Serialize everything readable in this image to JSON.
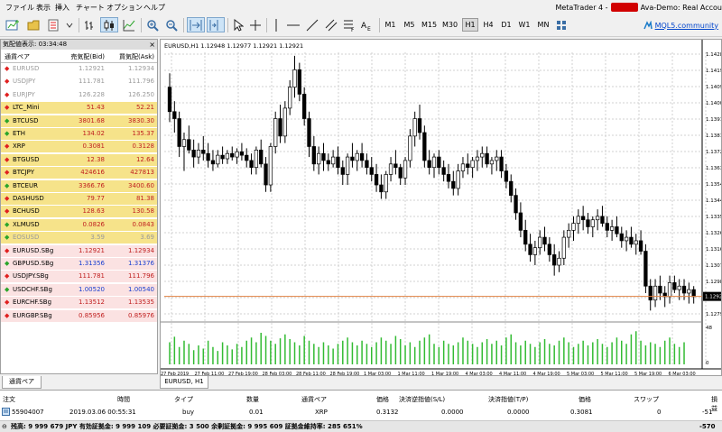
{
  "menu": [
    "ファイル",
    "表示",
    "挿入",
    "チャート",
    "オプション",
    "ヘルプ"
  ],
  "title": {
    "app": "MetaTrader 4 -",
    "account": "Ava-Demo: Real Accou"
  },
  "timeframes": [
    "M1",
    "M5",
    "M15",
    "M30",
    "H1",
    "H4",
    "D1",
    "W1",
    "MN"
  ],
  "selected_timeframe": "H1",
  "mql_link": "MQL5.community",
  "market_watch": {
    "title": "気配値表示: 03:34:48",
    "close": "×",
    "headers": {
      "symbol": "通貨ペア",
      "bid": "売気配(Bid)",
      "ask": "買気配(Ask)"
    },
    "rows": [
      {
        "symbol": "EURUSD",
        "bid": "1.12921",
        "ask": "1.12934",
        "dir": "down",
        "group": "dim"
      },
      {
        "symbol": "USDJPY",
        "bid": "111.781",
        "ask": "111.796",
        "dir": "down",
        "group": "dim"
      },
      {
        "symbol": "EURJPY",
        "bid": "126.228",
        "ask": "126.250",
        "dir": "down",
        "group": "dim"
      },
      {
        "symbol": "LTC_Mini",
        "bid": "51.43",
        "ask": "52.21",
        "dir": "down",
        "group": "crypto"
      },
      {
        "symbol": "BTCUSD",
        "bid": "3801.68",
        "ask": "3830.30",
        "dir": "up",
        "group": "crypto"
      },
      {
        "symbol": "ETH",
        "bid": "134.02",
        "ask": "135.37",
        "dir": "up",
        "group": "crypto"
      },
      {
        "symbol": "XRP",
        "bid": "0.3081",
        "ask": "0.3128",
        "dir": "down",
        "group": "crypto"
      },
      {
        "symbol": "BTGUSD",
        "bid": "12.38",
        "ask": "12.64",
        "dir": "down",
        "group": "crypto"
      },
      {
        "symbol": "BTCJPY",
        "bid": "424616",
        "ask": "427813",
        "dir": "down",
        "group": "crypto"
      },
      {
        "symbol": "BTCEUR",
        "bid": "3366.76",
        "ask": "3400.60",
        "dir": "up",
        "group": "crypto"
      },
      {
        "symbol": "DASHUSD",
        "bid": "79.77",
        "ask": "81.38",
        "dir": "down",
        "group": "crypto"
      },
      {
        "symbol": "BCHUSD",
        "bid": "128.63",
        "ask": "130.58",
        "dir": "down",
        "group": "crypto"
      },
      {
        "symbol": "XLMUSD",
        "bid": "0.0826",
        "ask": "0.0843",
        "dir": "up",
        "group": "crypto"
      },
      {
        "symbol": "EOSUSD",
        "bid": "3.59",
        "ask": "3.69",
        "dir": "up",
        "group": "crypto-dim"
      },
      {
        "symbol": "EURUSD.SBg",
        "bid": "1.12921",
        "ask": "1.12934",
        "dir": "down",
        "group": "sbg"
      },
      {
        "symbol": "GBPUSD.SBg",
        "bid": "1.31356",
        "ask": "1.31376",
        "dir": "up",
        "group": "sbg"
      },
      {
        "symbol": "USDJPY.SBg",
        "bid": "111.781",
        "ask": "111.796",
        "dir": "down",
        "group": "sbg"
      },
      {
        "symbol": "USDCHF.SBg",
        "bid": "1.00520",
        "ask": "1.00540",
        "dir": "up",
        "group": "sbg"
      },
      {
        "symbol": "EURCHF.SBg",
        "bid": "1.13512",
        "ask": "1.13535",
        "dir": "down",
        "group": "sbg"
      },
      {
        "symbol": "EURGBP.SBg",
        "bid": "0.85956",
        "ask": "0.85976",
        "dir": "down",
        "group": "sbg"
      }
    ],
    "tab": "通貨ペア"
  },
  "chart": {
    "header": "EURUSD,H1  1.12948 1.12977 1.12921 1.12921",
    "tab": "EURUSD, H1",
    "current_price": "1.12921",
    "price_ticks": [
      "1.14283",
      "1.14191",
      "1.14099",
      "1.14004",
      "1.13912",
      "1.13819",
      "1.13727",
      "1.13632",
      "1.13540",
      "1.13448",
      "1.13355",
      "1.13263",
      "1.13169",
      "1.13077",
      "1.12984",
      "1.12890",
      "1.12798"
    ],
    "time_ticks": [
      "27 Feb 2019",
      "27 Feb 11:00",
      "27 Feb 19:00",
      "28 Feb 03:00",
      "28 Feb 11:00",
      "28 Feb 19:00",
      "1 Mar 03:00",
      "1 Mar 11:00",
      "1 Mar 19:00",
      "4 Mar 03:00",
      "4 Mar 11:00",
      "4 Mar 19:00",
      "5 Mar 03:00",
      "5 Mar 11:00",
      "5 Mar 19:00",
      "6 Mar 03:00"
    ],
    "price_range": [
      1.1279,
      1.1432
    ],
    "candles": [
      [
        1.1412,
        1.142,
        1.1392,
        1.1398
      ],
      [
        1.1398,
        1.1404,
        1.1386,
        1.1394
      ],
      [
        1.1394,
        1.1398,
        1.1372,
        1.1378
      ],
      [
        1.1378,
        1.1386,
        1.1364,
        1.1382
      ],
      [
        1.1382,
        1.139,
        1.1374,
        1.1376
      ],
      [
        1.1376,
        1.1382,
        1.1366,
        1.1372
      ],
      [
        1.1372,
        1.138,
        1.1368,
        1.1376
      ],
      [
        1.1376,
        1.1384,
        1.137,
        1.1374
      ],
      [
        1.1374,
        1.138,
        1.1366,
        1.137
      ],
      [
        1.137,
        1.1376,
        1.1364,
        1.1368
      ],
      [
        1.1368,
        1.1376,
        1.1366,
        1.1373
      ],
      [
        1.1373,
        1.1378,
        1.1368,
        1.1371
      ],
      [
        1.1371,
        1.1376,
        1.1368,
        1.1374
      ],
      [
        1.1374,
        1.1378,
        1.137,
        1.1372
      ],
      [
        1.1372,
        1.1377,
        1.1368,
        1.1375
      ],
      [
        1.1375,
        1.138,
        1.137,
        1.1373
      ],
      [
        1.1373,
        1.1377,
        1.1366,
        1.137
      ],
      [
        1.137,
        1.1374,
        1.1362,
        1.1366
      ],
      [
        1.1366,
        1.1378,
        1.1362,
        1.1376
      ],
      [
        1.1376,
        1.1382,
        1.1366,
        1.1368
      ],
      [
        1.1368,
        1.1372,
        1.1352,
        1.1356
      ],
      [
        1.1356,
        1.138,
        1.1352,
        1.1378
      ],
      [
        1.1378,
        1.1398,
        1.1374,
        1.1394
      ],
      [
        1.1394,
        1.1402,
        1.138,
        1.1384
      ],
      [
        1.1384,
        1.1404,
        1.138,
        1.14
      ],
      [
        1.14,
        1.1416,
        1.1396,
        1.1412
      ],
      [
        1.1412,
        1.143,
        1.1406,
        1.1422
      ],
      [
        1.1422,
        1.1426,
        1.1404,
        1.1408
      ],
      [
        1.1408,
        1.1412,
        1.139,
        1.1394
      ],
      [
        1.1394,
        1.1398,
        1.1372,
        1.1378
      ],
      [
        1.1378,
        1.1384,
        1.1364,
        1.1368
      ],
      [
        1.1368,
        1.1378,
        1.1362,
        1.1374
      ],
      [
        1.1374,
        1.138,
        1.1364,
        1.137
      ],
      [
        1.137,
        1.1374,
        1.1364,
        1.1368
      ],
      [
        1.1368,
        1.1376,
        1.1366,
        1.1372
      ],
      [
        1.1372,
        1.1378,
        1.1362,
        1.1366
      ],
      [
        1.1366,
        1.137,
        1.1356,
        1.1362
      ],
      [
        1.1362,
        1.1374,
        1.1356,
        1.1372
      ],
      [
        1.1372,
        1.138,
        1.1366,
        1.137
      ],
      [
        1.137,
        1.1376,
        1.1364,
        1.1374
      ],
      [
        1.1374,
        1.138,
        1.1366,
        1.137
      ],
      [
        1.137,
        1.1374,
        1.1362,
        1.1366
      ],
      [
        1.1366,
        1.1372,
        1.1358,
        1.1362
      ],
      [
        1.1362,
        1.1368,
        1.1352,
        1.1356
      ],
      [
        1.1356,
        1.1362,
        1.1348,
        1.1352
      ],
      [
        1.1352,
        1.1364,
        1.1348,
        1.1362
      ],
      [
        1.1362,
        1.1372,
        1.1358,
        1.1368
      ],
      [
        1.1368,
        1.1376,
        1.1362,
        1.1366
      ],
      [
        1.1366,
        1.1368,
        1.1356,
        1.136
      ],
      [
        1.136,
        1.1372,
        1.1356,
        1.137
      ],
      [
        1.137,
        1.1388,
        1.1366,
        1.1384
      ],
      [
        1.1384,
        1.1398,
        1.1378,
        1.1394
      ],
      [
        1.1394,
        1.1402,
        1.1382,
        1.1386
      ],
      [
        1.1386,
        1.139,
        1.1366,
        1.137
      ],
      [
        1.137,
        1.1376,
        1.1362,
        1.1366
      ],
      [
        1.1366,
        1.1374,
        1.136,
        1.1372
      ],
      [
        1.1372,
        1.1376,
        1.1362,
        1.1366
      ],
      [
        1.1366,
        1.137,
        1.1358,
        1.1362
      ],
      [
        1.1362,
        1.1368,
        1.1354,
        1.1358
      ],
      [
        1.1358,
        1.1364,
        1.135,
        1.1354
      ],
      [
        1.1354,
        1.1368,
        1.135,
        1.1364
      ],
      [
        1.1364,
        1.1372,
        1.136,
        1.1368
      ],
      [
        1.1368,
        1.1374,
        1.1362,
        1.1366
      ],
      [
        1.1366,
        1.1372,
        1.136,
        1.137
      ],
      [
        1.137,
        1.1376,
        1.1364,
        1.1372
      ],
      [
        1.1372,
        1.1378,
        1.1366,
        1.1374
      ],
      [
        1.1374,
        1.1378,
        1.1366,
        1.1368
      ],
      [
        1.1368,
        1.1372,
        1.1362,
        1.137
      ],
      [
        1.137,
        1.1376,
        1.1364,
        1.1372
      ],
      [
        1.1372,
        1.1376,
        1.136,
        1.1364
      ],
      [
        1.1364,
        1.1368,
        1.1354,
        1.1358
      ],
      [
        1.1358,
        1.1362,
        1.1346,
        1.135
      ],
      [
        1.135,
        1.1354,
        1.1336,
        1.134
      ],
      [
        1.134,
        1.1346,
        1.1326,
        1.133
      ],
      [
        1.133,
        1.1336,
        1.1318,
        1.1322
      ],
      [
        1.1322,
        1.1328,
        1.1312,
        1.1316
      ],
      [
        1.1316,
        1.1324,
        1.131,
        1.132
      ],
      [
        1.132,
        1.133,
        1.1316,
        1.1326
      ],
      [
        1.1326,
        1.1332,
        1.1318,
        1.1322
      ],
      [
        1.1322,
        1.1326,
        1.1312,
        1.1316
      ],
      [
        1.1316,
        1.1322,
        1.1304,
        1.131
      ],
      [
        1.131,
        1.1318,
        1.1306,
        1.1314
      ],
      [
        1.1314,
        1.133,
        1.131,
        1.1326
      ],
      [
        1.1326,
        1.1334,
        1.132,
        1.133
      ],
      [
        1.133,
        1.1338,
        1.1324,
        1.1334
      ],
      [
        1.1334,
        1.1342,
        1.1328,
        1.1338
      ],
      [
        1.1338,
        1.1344,
        1.133,
        1.1336
      ],
      [
        1.1336,
        1.134,
        1.1328,
        1.1332
      ],
      [
        1.1332,
        1.1338,
        1.1326,
        1.1336
      ],
      [
        1.1336,
        1.1342,
        1.133,
        1.1338
      ],
      [
        1.1338,
        1.1344,
        1.1332,
        1.1334
      ],
      [
        1.1334,
        1.1338,
        1.1326,
        1.133
      ],
      [
        1.133,
        1.1336,
        1.1324,
        1.1332
      ],
      [
        1.1332,
        1.1338,
        1.1326,
        1.1328
      ],
      [
        1.1328,
        1.1332,
        1.132,
        1.1324
      ],
      [
        1.1324,
        1.133,
        1.1318,
        1.1326
      ],
      [
        1.1326,
        1.1332,
        1.132,
        1.1322
      ],
      [
        1.1322,
        1.1328,
        1.1316,
        1.1324
      ],
      [
        1.1324,
        1.133,
        1.1316,
        1.1318
      ],
      [
        1.1318,
        1.1322,
        1.1294,
        1.1298
      ],
      [
        1.1298,
        1.1302,
        1.1284,
        1.129
      ],
      [
        1.129,
        1.1302,
        1.1286,
        1.1298
      ],
      [
        1.1298,
        1.1304,
        1.129,
        1.1294
      ],
      [
        1.1294,
        1.1298,
        1.1286,
        1.1292
      ],
      [
        1.1292,
        1.1304,
        1.1288,
        1.13
      ],
      [
        1.13,
        1.1304,
        1.1294,
        1.1296
      ],
      [
        1.1296,
        1.1302,
        1.129,
        1.1298
      ],
      [
        1.1298,
        1.1302,
        1.129,
        1.1294
      ],
      [
        1.1294,
        1.13,
        1.1288,
        1.1296
      ],
      [
        1.1296,
        1.1298,
        1.1288,
        1.1292
      ]
    ],
    "volumes": [
      28,
      35,
      22,
      30,
      26,
      18,
      24,
      20,
      30,
      22,
      17,
      28,
      24,
      19,
      26,
      22,
      30,
      34,
      28,
      40,
      36,
      30,
      26,
      33,
      38,
      32,
      28,
      24,
      36,
      30,
      26,
      22,
      28,
      24,
      20,
      26,
      30,
      34,
      28,
      24,
      30,
      26,
      22,
      28,
      34,
      30,
      26,
      36,
      32,
      24,
      28,
      22,
      30,
      34,
      38,
      26,
      22,
      30,
      26,
      24,
      28,
      34,
      30,
      26,
      22,
      28,
      32,
      26,
      30,
      24,
      34,
      38,
      28,
      24,
      30,
      26,
      22,
      28,
      32,
      26,
      24,
      30,
      34,
      28,
      22,
      26,
      30,
      24,
      28,
      32,
      26,
      22,
      28,
      34,
      30,
      26,
      38,
      42,
      30,
      24,
      28,
      26,
      22,
      30,
      34,
      26,
      22,
      28
    ],
    "volume_ticks": [
      "48",
      "0"
    ]
  },
  "terminal": {
    "headers": [
      "注文",
      "時間",
      "タイプ",
      "数量",
      "通貨ペア",
      "価格",
      "決済逆指値(S/L)",
      "決済指値(T/P)",
      "価格",
      "スワップ",
      "損益"
    ],
    "row": [
      "55904007",
      "2019.03.06 00:55:31",
      "buy",
      "0.01",
      "XRP",
      "0.3132",
      "0.0000",
      "0.0000",
      "0.3081",
      "0",
      "-51"
    ],
    "status": "残高: 9 999 679 JPY  有効証拠金: 9 999 109  必要証拠金: 3 500  余剰証拠金: 9 995 609  証拠金維持率: 285 651%",
    "total": "-570"
  },
  "colors": {
    "up_arrow": "#2aa52a",
    "down_arrow": "#e02020",
    "crypto_bg": "#f6e38a",
    "sbg_bg": "#fbe2e2",
    "dim_text": "#9a9a9a",
    "price_line": "#e08040",
    "volume": "#33bb33"
  }
}
